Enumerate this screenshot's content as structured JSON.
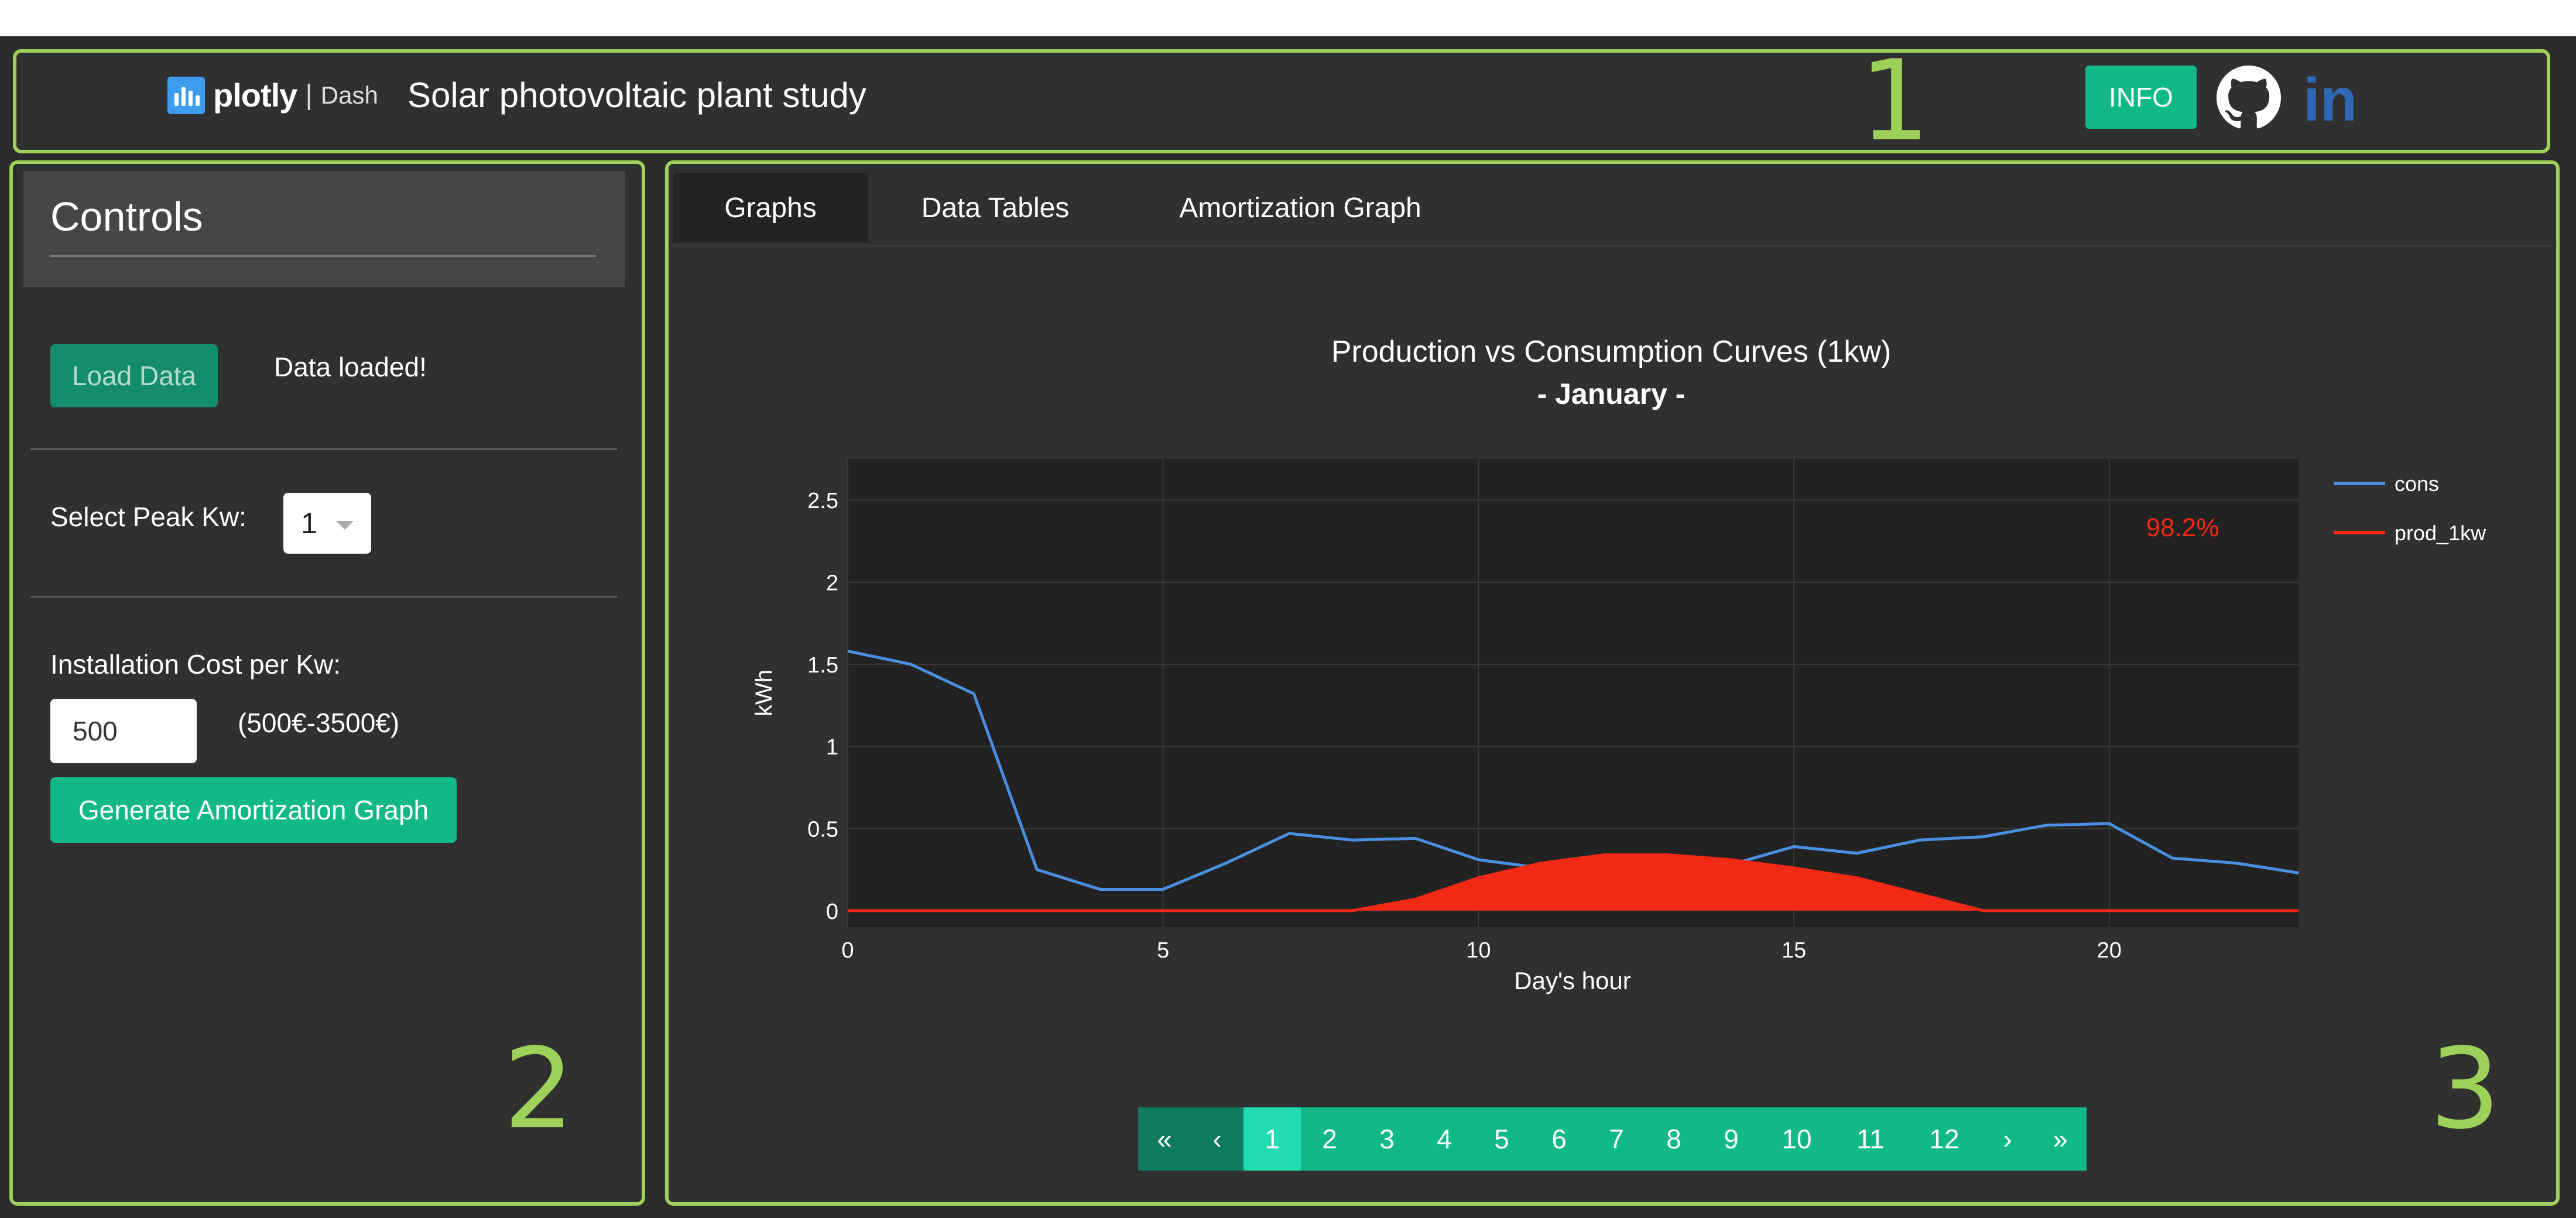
{
  "header": {
    "logo_text": "plotly",
    "logo_sep": "|",
    "logo_sub": "Dash",
    "title": "Solar photovoltaic plant study",
    "info_label": "INFO",
    "icons": [
      "plotly-logo-icon",
      "github-icon",
      "linkedin-icon"
    ]
  },
  "annotations": {
    "one": "1",
    "two": "2",
    "three": "3"
  },
  "controls": {
    "title": "Controls",
    "load_button": "Load Data",
    "loaded_text": "Data loaded!",
    "peak_label": "Select Peak Kw:",
    "peak_value": "1",
    "cost_label": "Installation Cost per Kw:",
    "cost_value": "500",
    "cost_range": "(500€-3500€)",
    "generate_button": "Generate Amortization Graph"
  },
  "tabs": [
    "Graphs",
    "Data Tables",
    "Amortization Graph"
  ],
  "active_tab": 0,
  "chart_data": {
    "type": "line",
    "title": "Production vs Consumption Curves (1kw)",
    "subtitle": "- January -",
    "xlabel": "Day's hour",
    "ylabel": "kWh",
    "xlim": [
      0,
      23
    ],
    "ylim": [
      -0.1,
      2.75
    ],
    "x_ticks": [
      0,
      5,
      10,
      15,
      20
    ],
    "y_ticks": [
      0,
      0.5,
      1,
      1.5,
      2,
      2.5
    ],
    "y_tick_labels": [
      "0",
      "0.5",
      "1",
      "1.5",
      "2",
      "2.5"
    ],
    "grid": true,
    "annotation": "98.2%",
    "legend_position": "right",
    "x": [
      0,
      1,
      2,
      3,
      4,
      5,
      6,
      7,
      8,
      9,
      10,
      11,
      12,
      13,
      14,
      15,
      16,
      17,
      18,
      19,
      20,
      21,
      22,
      23
    ],
    "series": [
      {
        "name": "cons",
        "color": "#4a90e2",
        "fill": false,
        "values": [
          1.58,
          1.5,
          1.32,
          0.25,
          0.13,
          0.13,
          0.29,
          0.47,
          0.43,
          0.44,
          0.31,
          0.26,
          0.34,
          0.34,
          0.28,
          0.39,
          0.35,
          0.43,
          0.45,
          0.52,
          0.53,
          0.32,
          0.29,
          0.23
        ]
      },
      {
        "name": "prod_1kw",
        "color": "#f22a15",
        "fill": true,
        "values": [
          0,
          0,
          0,
          0,
          0,
          0,
          0,
          0,
          0,
          0.07,
          0.2,
          0.29,
          0.34,
          0.34,
          0.31,
          0.26,
          0.2,
          0.1,
          0,
          0,
          0,
          0,
          0,
          0
        ]
      }
    ]
  },
  "pagination": {
    "first": "«",
    "prev": "‹",
    "next": "›",
    "last": "»",
    "pages": [
      "1",
      "2",
      "3",
      "4",
      "5",
      "6",
      "7",
      "8",
      "9",
      "10",
      "11",
      "12"
    ],
    "active": "1"
  },
  "colors": {
    "accent": "#11b989",
    "outline": "#9ed15a",
    "panel": "#303030"
  }
}
